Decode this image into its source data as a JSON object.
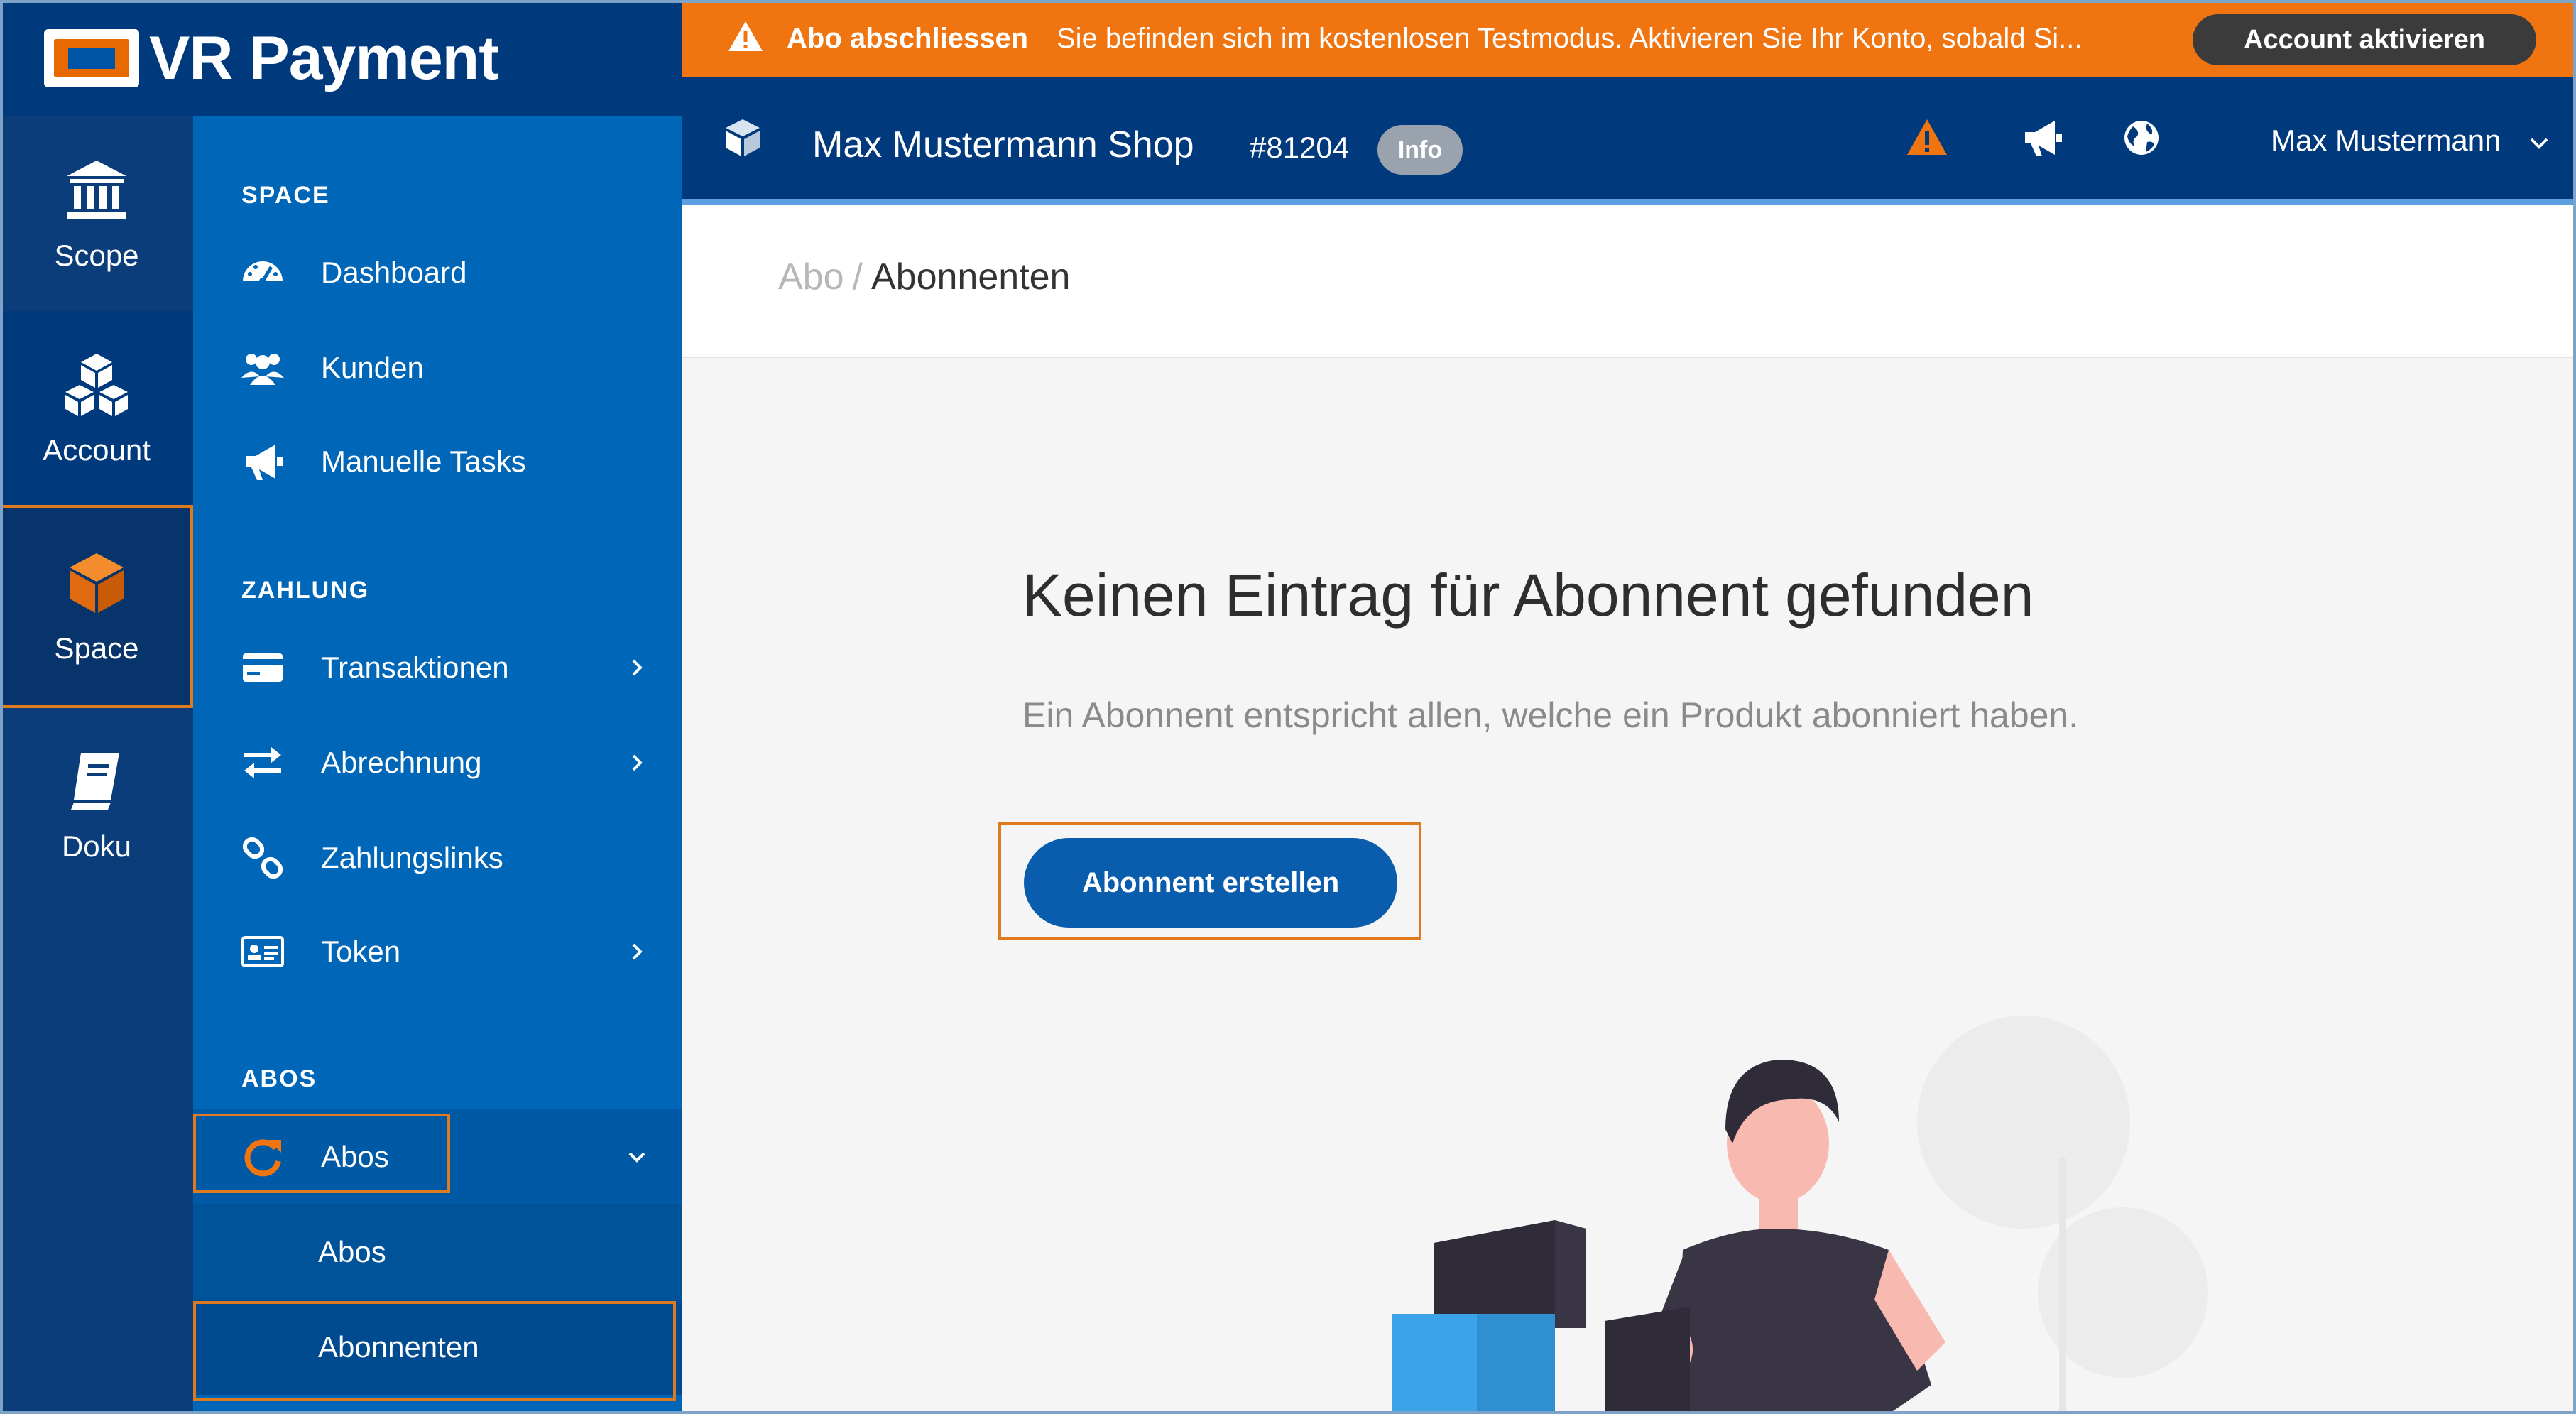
{
  "brand": {
    "name": "VR Payment"
  },
  "rail": {
    "items": [
      {
        "label": "Scope",
        "icon": "bank-icon"
      },
      {
        "label": "Account",
        "icon": "boxes-icon"
      },
      {
        "label": "Space",
        "icon": "cube-icon",
        "active": true
      },
      {
        "label": "Doku",
        "icon": "book-icon"
      }
    ]
  },
  "sidebar": {
    "sections": [
      {
        "title": "SPACE",
        "items": [
          {
            "label": "Dashboard",
            "icon": "dashboard-icon"
          },
          {
            "label": "Kunden",
            "icon": "users-icon"
          },
          {
            "label": "Manuelle Tasks",
            "icon": "megaphone-icon"
          }
        ]
      },
      {
        "title": "ZAHLUNG",
        "items": [
          {
            "label": "Transaktionen",
            "icon": "credit-card-icon",
            "expandable": true
          },
          {
            "label": "Abrechnung",
            "icon": "exchange-icon",
            "expandable": true
          },
          {
            "label": "Zahlungslinks",
            "icon": "link-icon"
          },
          {
            "label": "Token",
            "icon": "id-card-icon",
            "expandable": true
          }
        ]
      },
      {
        "title": "ABOS",
        "items": [
          {
            "label": "Abos",
            "icon": "refresh-icon",
            "expanded": true,
            "children": [
              {
                "label": "Abos"
              },
              {
                "label": "Abonnenten",
                "active": true
              }
            ]
          }
        ]
      }
    ]
  },
  "alert": {
    "title": "Abo abschliessen",
    "message": "Sie befinden sich im kostenlosen Testmodus. Aktivieren Sie Ihr Konto, sobald Si...",
    "button": "Account aktivieren",
    "color": "#f0740f"
  },
  "header": {
    "shop_name": "Max Mustermann Shop",
    "shop_id": "#81204",
    "badge": "Info",
    "user": "Max Mustermann"
  },
  "breadcrumb": {
    "parent": "Abo",
    "separator": "/",
    "current": "Abonnenten"
  },
  "empty_state": {
    "title": "Keinen Eintrag für Abonnent gefunden",
    "description": "Ein Abonnent entspricht allen, welche ein Produkt abonniert haben.",
    "button": "Abonnent erstellen"
  },
  "colors": {
    "rail": "#0a3d79",
    "sidebar": "#0066b8",
    "header": "#003a7d",
    "highlight": "#e07a1f",
    "primary_button": "#0a5cad"
  }
}
